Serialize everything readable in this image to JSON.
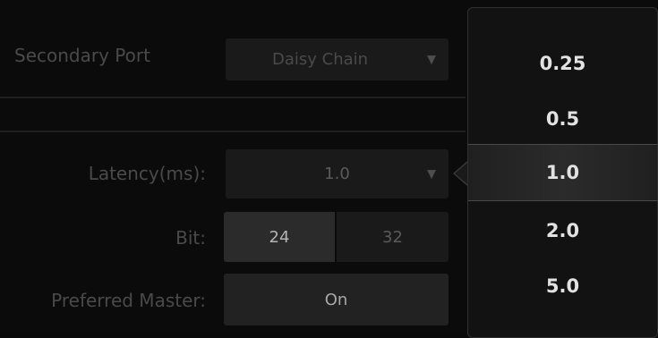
{
  "settings": {
    "secondary_port": {
      "label": "Secondary Port",
      "value": "Daisy Chain",
      "arrow": "▼"
    },
    "latency": {
      "label": "Latency(ms):",
      "value": "1.0",
      "arrow": "▼"
    },
    "bit": {
      "label": "Bit:",
      "options": [
        "24",
        "32"
      ],
      "selected": "24"
    },
    "preferred_master": {
      "label": "Preferred Master:",
      "value": "On"
    }
  },
  "latency_dropdown": {
    "options": [
      "0.25",
      "0.5",
      "1.0",
      "2.0",
      "5.0"
    ],
    "selected": "1.0"
  },
  "colors": {
    "background": "#0b0b0b",
    "button": "#1a1a1a",
    "popup": "#121212",
    "popup_text": "#e2e2e2"
  }
}
